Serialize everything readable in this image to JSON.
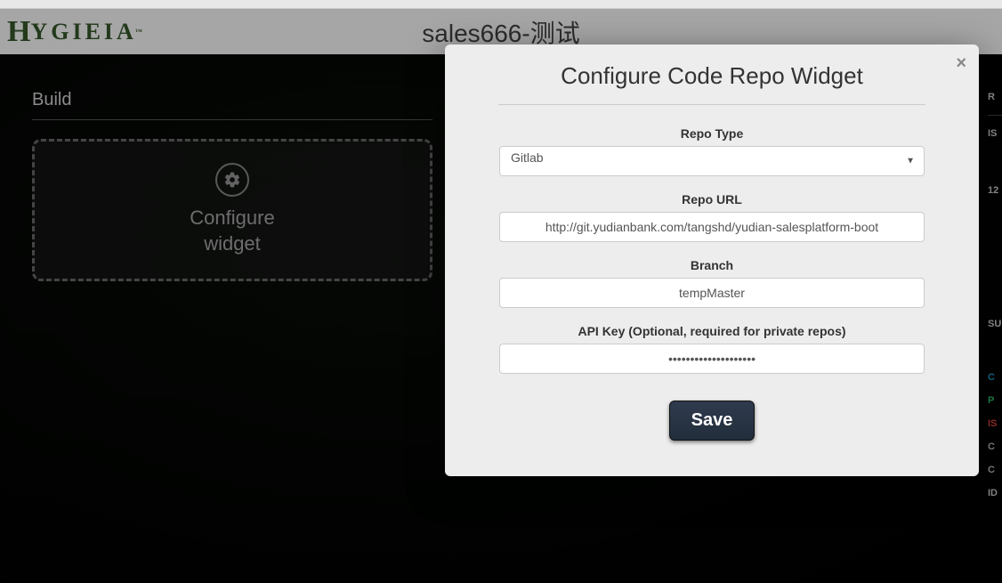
{
  "header": {
    "logo_text": "HYGIEIA",
    "dashboard_title": "sales666-测试"
  },
  "build_panel": {
    "title": "Build",
    "configure_label_line1": "Configure",
    "configure_label_line2": "widget"
  },
  "right_strip": {
    "r": "R",
    "is": "IS",
    "n12": "12",
    "su": "SU",
    "c1": "C",
    "p": "P",
    "is2": "IS",
    "c2": "C",
    "c3": "C",
    "id": "ID"
  },
  "modal": {
    "title": "Configure Code Repo Widget",
    "close_glyph": "×",
    "repo_type_label": "Repo Type",
    "repo_type_value": "Gitlab",
    "repo_url_label": "Repo URL",
    "repo_url_value": "http://git.yudianbank.com/tangshd/yudian-salesplatform-boot",
    "branch_label": "Branch",
    "branch_value": "tempMaster",
    "api_key_label": "API Key (Optional, required for private repos)",
    "api_key_value": "••••••••••••••••••••",
    "save_label": "Save"
  }
}
